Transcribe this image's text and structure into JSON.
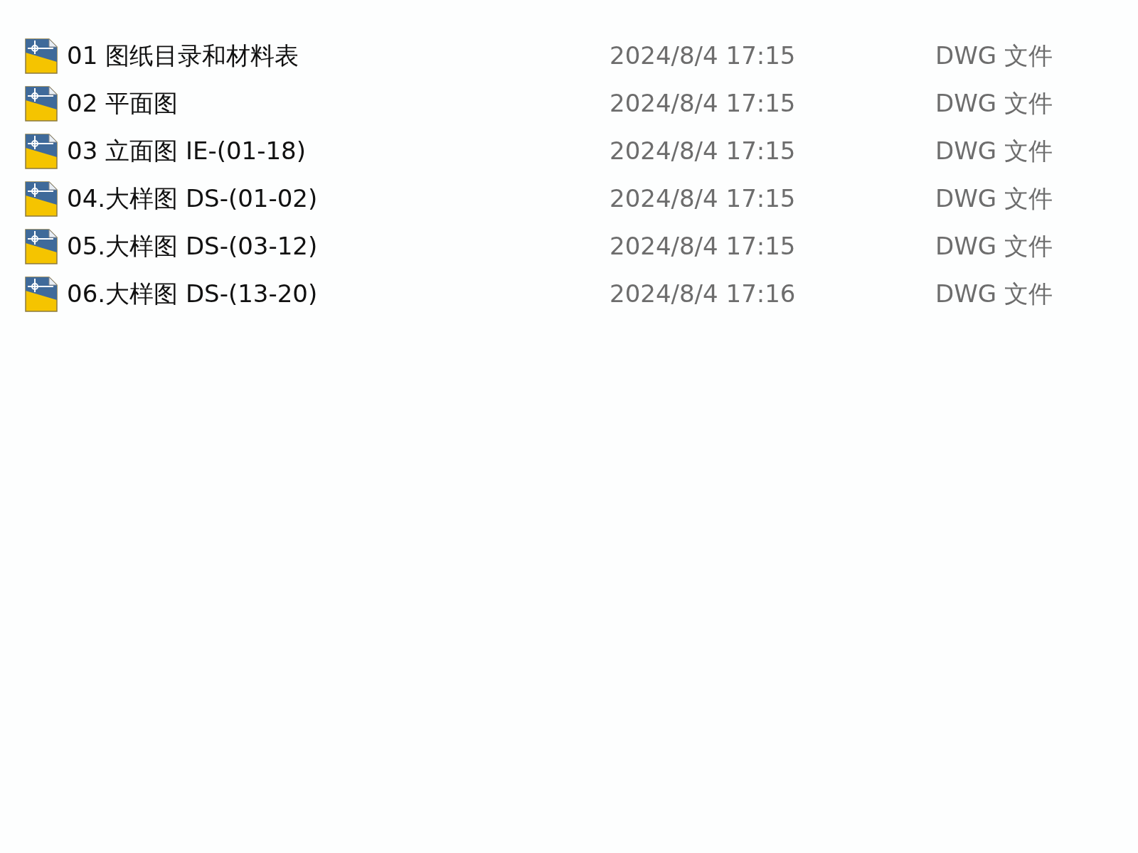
{
  "files": [
    {
      "name": "01 图纸目录和材料表",
      "modified": "2024/8/4 17:15",
      "type": "DWG 文件"
    },
    {
      "name": "02 平面图",
      "modified": "2024/8/4 17:15",
      "type": "DWG 文件"
    },
    {
      "name": "03 立面图 IE-(01-18)",
      "modified": "2024/8/4 17:15",
      "type": "DWG 文件"
    },
    {
      "name": "04.大样图 DS-(01-02)",
      "modified": "2024/8/4 17:15",
      "type": "DWG 文件"
    },
    {
      "name": "05.大样图 DS-(03-12)",
      "modified": "2024/8/4 17:15",
      "type": "DWG 文件"
    },
    {
      "name": "06.大样图 DS-(13-20)",
      "modified": "2024/8/4 17:16",
      "type": "DWG 文件"
    }
  ]
}
